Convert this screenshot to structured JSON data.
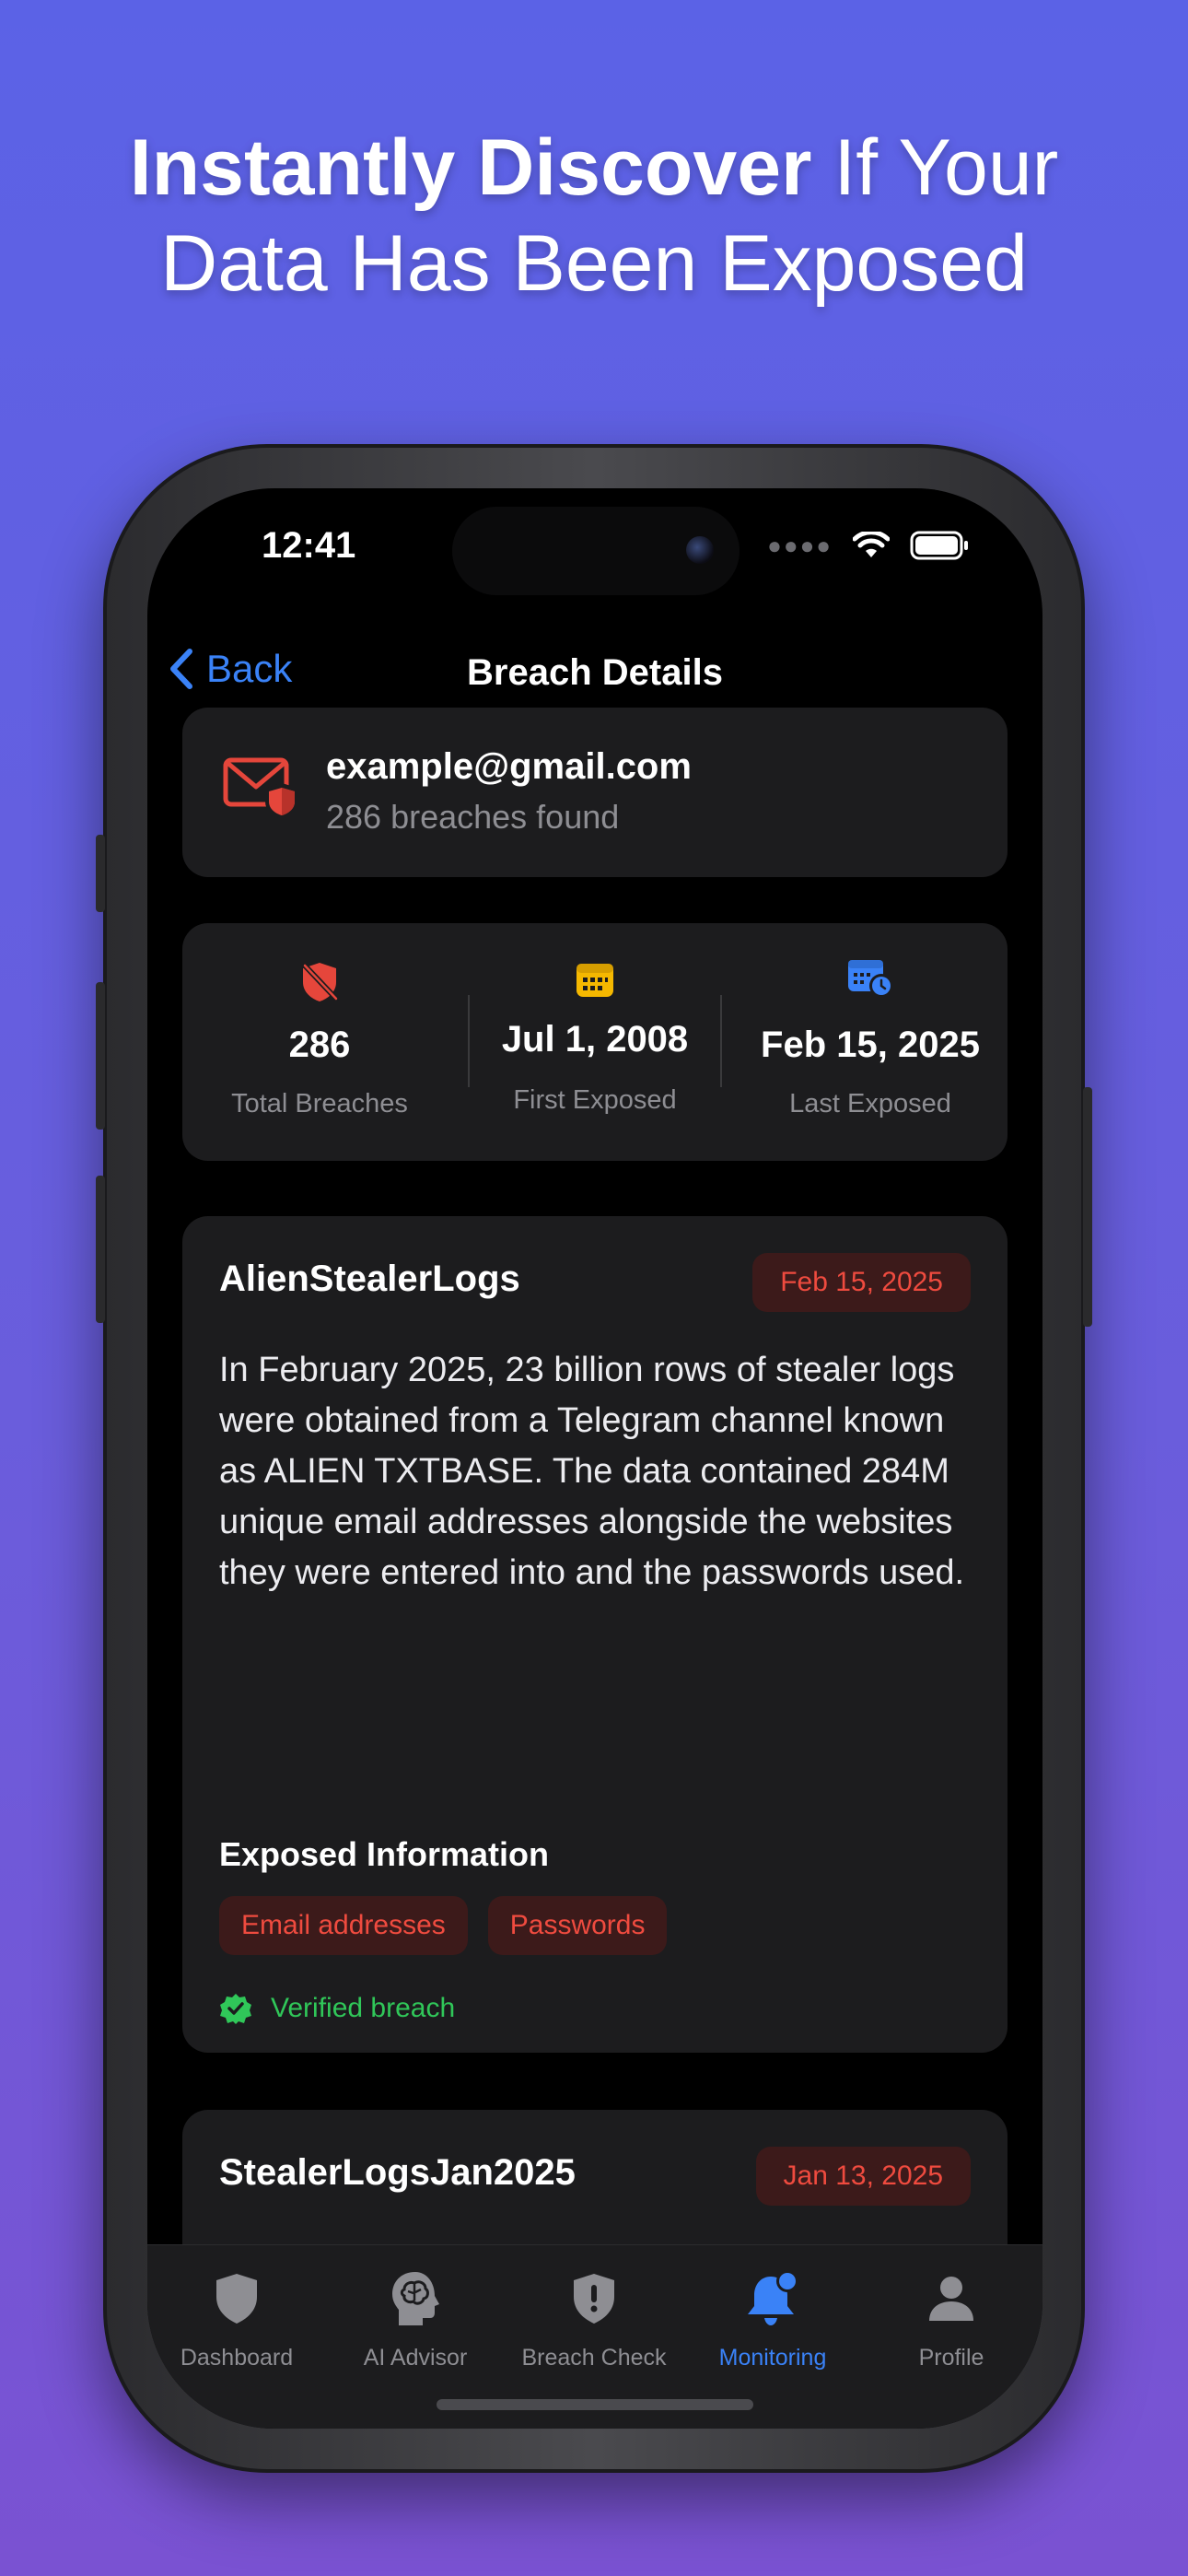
{
  "headline": {
    "bold": "Instantly Discover",
    "rest_line1": " If Your",
    "line2": "Data Has Been Exposed"
  },
  "status_bar": {
    "time": "12:41"
  },
  "nav": {
    "back_label": "Back",
    "title": "Breach Details"
  },
  "account": {
    "email": "example@gmail.com",
    "summary": "286 breaches found"
  },
  "stats": [
    {
      "icon": "shield-slash-icon",
      "value": "286",
      "label": "Total Breaches",
      "color": "#e5463b"
    },
    {
      "icon": "calendar-icon",
      "value": "Jul 1, 2008",
      "label": "First Exposed",
      "color": "#f5b800"
    },
    {
      "icon": "calendar-clock-icon",
      "value": "Feb 15, 2025",
      "label": "Last Exposed",
      "color": "#3a82f7"
    }
  ],
  "breaches": [
    {
      "name": "AlienStealerLogs",
      "date": "Feb 15, 2025",
      "description": "In February 2025, 23 billion rows of stealer logs were obtained from a Telegram channel known as ALIEN TXTBASE. The data contained 284M unique email addresses alongside the websites they were entered into and the passwords used.",
      "exposed_heading": "Exposed Information",
      "exposed": [
        "Email addresses",
        "Passwords"
      ],
      "verified_label": "Verified breach"
    },
    {
      "name": "StealerLogsJan2025",
      "date": "Jan 13, 2025"
    }
  ],
  "tabs": [
    {
      "label": "Dashboard",
      "icon": "shield-icon",
      "active": false
    },
    {
      "label": "AI Advisor",
      "icon": "brain-head-icon",
      "active": false
    },
    {
      "label": "Breach Check",
      "icon": "shield-exclamation-icon",
      "active": false
    },
    {
      "label": "Monitoring",
      "icon": "bell-badge-icon",
      "active": true
    },
    {
      "label": "Profile",
      "icon": "person-icon",
      "active": false
    }
  ],
  "colors": {
    "accent": "#3a82f7",
    "danger": "#ef4b3f",
    "success": "#30c759",
    "card": "#1c1c1e"
  }
}
